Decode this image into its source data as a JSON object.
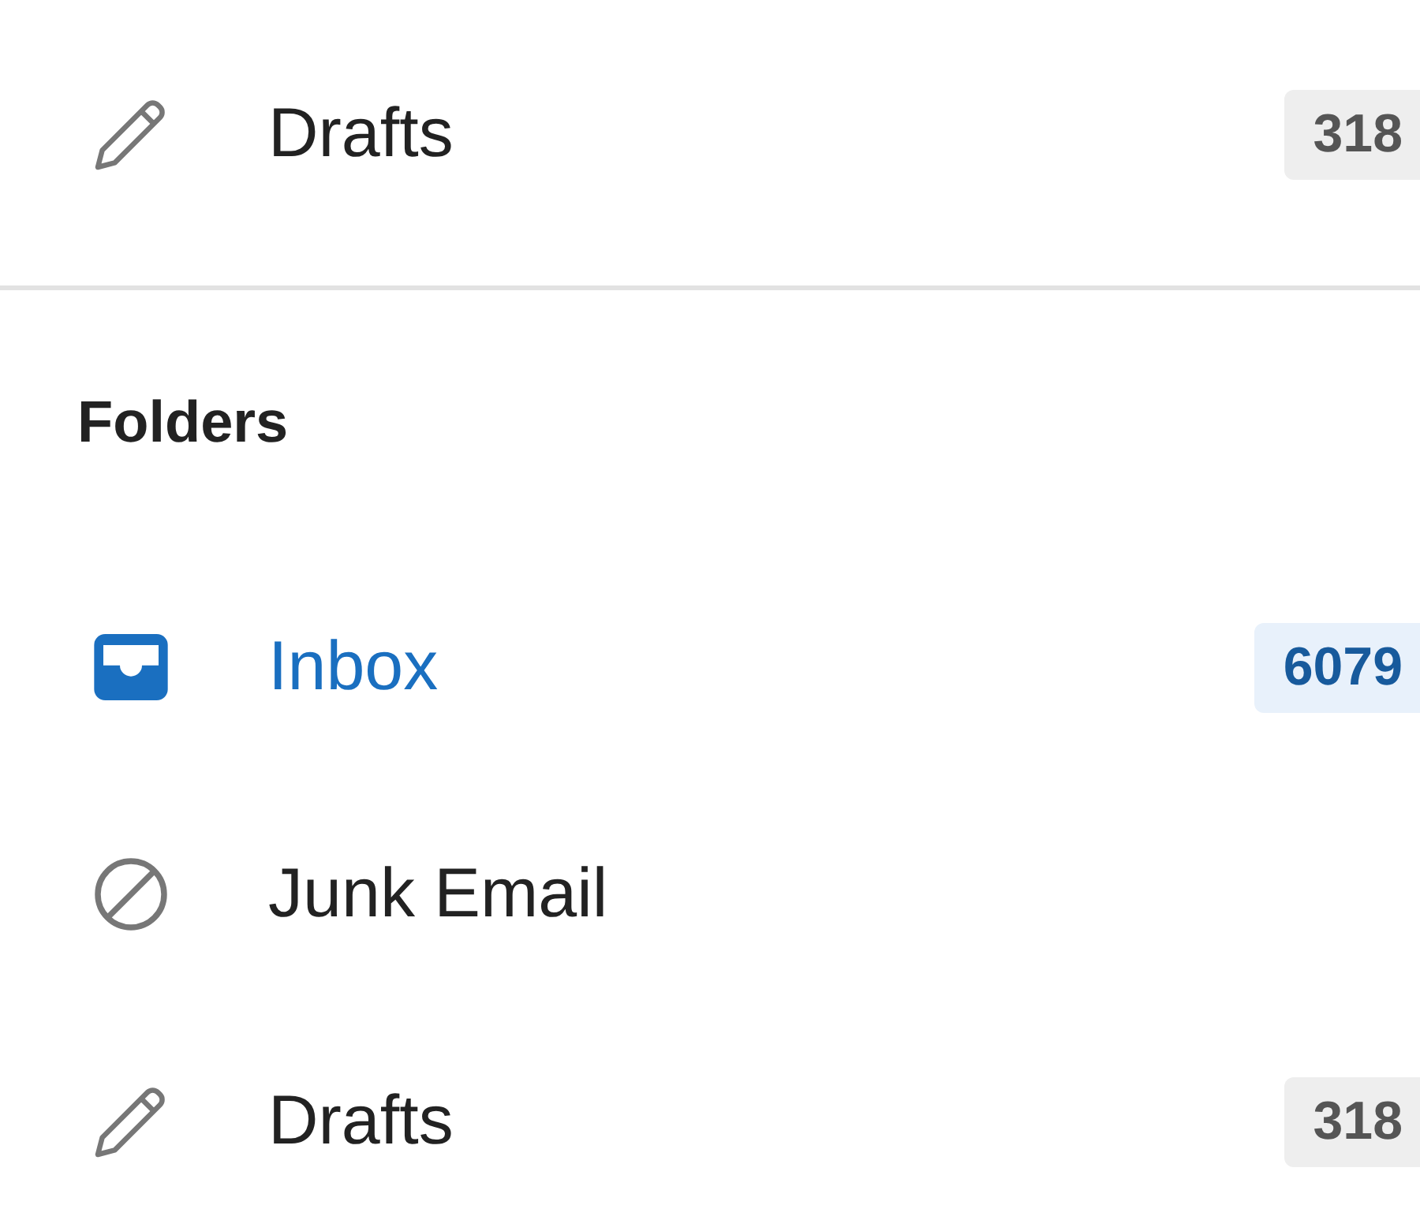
{
  "favorites": [
    {
      "kind": "drafts",
      "label": "Drafts",
      "count": "318",
      "selected": false
    }
  ],
  "folders": {
    "title": "Folders",
    "items": [
      {
        "kind": "inbox",
        "label": "Inbox",
        "count": "6079",
        "selected": true
      },
      {
        "kind": "junk",
        "label": "Junk Email",
        "selected": false
      },
      {
        "kind": "drafts",
        "label": "Drafts",
        "count": "318",
        "selected": false
      }
    ]
  }
}
